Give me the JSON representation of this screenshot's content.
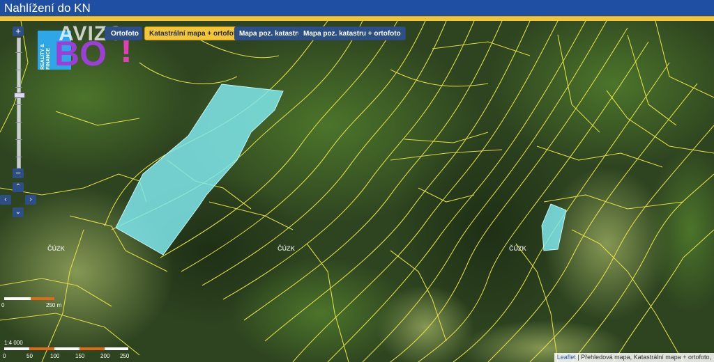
{
  "window": {
    "title": "Nahlížení do KN"
  },
  "layers": {
    "orthophoto_partial": "Ortofoto",
    "cadastral_ortho": "Katastrální mapa + ortofoto",
    "map_katastr": "Mapa poz. katastru",
    "map_katastr_ortho": "Mapa poz. katastru + ortofoto",
    "active": "Katastrální mapa + ortofoto"
  },
  "zoom": {
    "plus": "+",
    "minus": "−"
  },
  "pan": {
    "up": "⌃",
    "left": "‹",
    "right": "›",
    "down": "⌄"
  },
  "logo": {
    "word": "AVIZO",
    "letters": "BO",
    "bang": "!",
    "side_text": "REALITY & FINANCE"
  },
  "map_labels": {
    "cuzk": "ČÚZK"
  },
  "scale_top": {
    "labels": [
      "0",
      "250 m"
    ]
  },
  "scale_bottom": {
    "ratio": "1:4 000",
    "labels": [
      "0",
      "50",
      "100",
      "150",
      "200",
      "250"
    ]
  },
  "attribution": {
    "leaflet": "Leaflet",
    "rest": "| Přehledová mapa, Katastrální mapa + ortofoto,"
  },
  "colors": {
    "highlight": "#7fe8ec",
    "parcel_lines": "#e8e04a",
    "title_bg": "#1f4fa3",
    "stripe": "#f3c63a"
  }
}
